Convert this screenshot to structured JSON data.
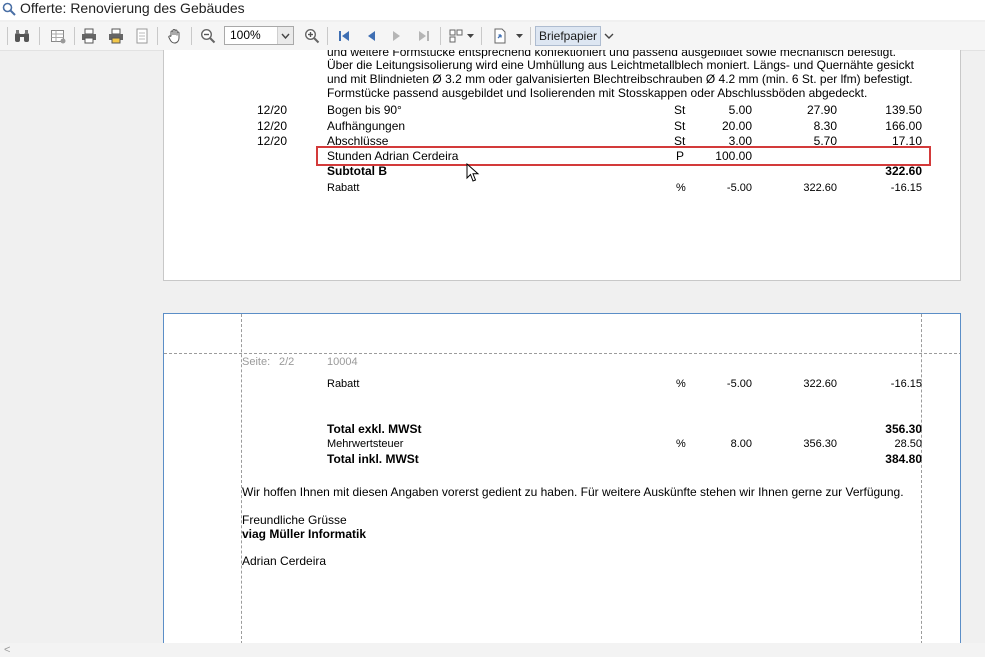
{
  "window": {
    "title": "Offerte: Renovierung des Gebäudes"
  },
  "toolbar": {
    "zoom_value": "100%",
    "briefpapier_label": "Briefpapier",
    "icons": [
      "binoculars-icon",
      "grid-icon",
      "print-icon",
      "print-setup-icon",
      "page-icon",
      "hand-icon",
      "zoom-out-icon",
      "zoom-in-icon",
      "first-page-icon",
      "prev-page-icon",
      "next-page-icon",
      "last-page-icon",
      "multipage-icon",
      "export-icon"
    ]
  },
  "page1": {
    "intro_lines": [
      "und weitere Formstücke entsprechend konfektioniert und passend ausgebildet sowie mechanisch befestigt.",
      "Über die Leitungsisolierung wird eine Umhüllung aus Leichtmetallblech moniert. Längs- und Quernähte gesickt",
      "und mit Blindnieten Ø 3.2 mm oder galvanisierten Blechtreibschrauben Ø 4.2 mm (min. 6 St. per lfm) befestigt.",
      "Formstücke passend ausgebildet und Isolierenden mit Stosskappen oder Abschlussböden abgedeckt."
    ],
    "rows": [
      {
        "code": "12/20",
        "desc": "Bogen bis 90°",
        "unit": "St",
        "qty": "5.00",
        "price": "27.90",
        "total": "139.50"
      },
      {
        "code": "12/20",
        "desc": "Aufhängungen",
        "unit": "St",
        "qty": "20.00",
        "price": "8.30",
        "total": "166.00"
      },
      {
        "code": "12/20",
        "desc": "Abschlüsse",
        "unit": "St",
        "qty": "3.00",
        "price": "5.70",
        "total": "17.10"
      },
      {
        "code": "",
        "desc": "Stunden Adrian Cerdeira",
        "unit": "P",
        "qty": "100.00",
        "price": "",
        "total": ""
      }
    ],
    "subtotal": {
      "label": "Subtotal B",
      "total": "322.60"
    },
    "rabatt": {
      "label": "Rabatt",
      "unit": "%",
      "qty": "-5.00",
      "price": "322.60",
      "total": "-16.15"
    }
  },
  "page2": {
    "header": {
      "seite_label": "Seite:",
      "seite_value": "2/2",
      "doc_no": "10004"
    },
    "rabatt": {
      "label": "Rabatt",
      "unit": "%",
      "qty": "-5.00",
      "price": "322.60",
      "total": "-16.15"
    },
    "total_excl": {
      "label": "Total exkl. MWSt",
      "total": "356.30"
    },
    "mwst": {
      "label": "Mehrwertsteuer",
      "unit": "%",
      "qty": "8.00",
      "price": "356.30",
      "total": "28.50"
    },
    "total_incl": {
      "label": "Total inkl. MWSt",
      "total": "384.80"
    },
    "closing": "Wir hoffen Ihnen mit diesen Angaben vorerst gedient zu haben. Für weitere Auskünfte stehen wir Ihnen gerne zur Verfügung.",
    "greeting": "Freundliche Grüsse",
    "company": "viag Müller Informatik",
    "signature": "Adrian Cerdeira"
  },
  "colors": {
    "highlight_border": "#d33a3a",
    "active_page_border": "#5b8ec7",
    "briefpapier_bg": "#dde6f2"
  }
}
